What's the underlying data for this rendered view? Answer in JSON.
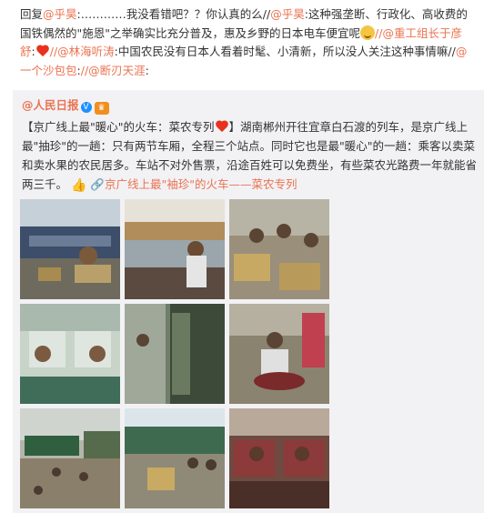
{
  "comment": {
    "reply_label": "回复",
    "mention1": "@乎昊",
    "dots": ":…………",
    "text1": "我没看错吧？？你认真的么//",
    "mention2": "@乎昊",
    "text2": ":这种强垄断、行政化、高收费的国铁偶然的\"施恩\"之举确实比充分普及，惠及乡野的日本电车便宜呢",
    "mention3": "//@重工组长于彦舒",
    "text3": ":",
    "mention4": "//@林海听涛",
    "text4": ":中国农民没有日本人看着时髦、小清新，所以没人关注这种事情嘛//",
    "mention5": "@一个沙包包",
    "text5": ":",
    "mention6": "//@断刃天涯",
    "text6": ":"
  },
  "repost": {
    "source_name": "@人民日报",
    "verify_icon": "verified-v",
    "tag_open": "【京广线上最\"暖心\"的火车：菜农专列",
    "tag_close": "】",
    "body": "湖南郴州开往宜章白石渡的列车，是京广线上最\"抽珍\"的一趟：只有两节车厢，全程三个站点。同时它也是最\"暖心\"的一趟：乘客以卖菜和卖水果的农民居多。车站不对外售票，沿途百姓可以免费坐，有些菜农光路费一年就能省两三千。",
    "link_text": "京广线上最\"袖珍\"的火车——菜农专列",
    "link_icon": "link-icon"
  },
  "photos": [
    {
      "label": "photo-1"
    },
    {
      "label": "photo-2"
    },
    {
      "label": "photo-3"
    },
    {
      "label": "photo-4"
    },
    {
      "label": "photo-5"
    },
    {
      "label": "photo-6"
    },
    {
      "label": "photo-7"
    },
    {
      "label": "photo-8"
    },
    {
      "label": "photo-9"
    }
  ],
  "colors": {
    "mention": "#eb7350",
    "repost_bg": "#f2f2f5"
  }
}
